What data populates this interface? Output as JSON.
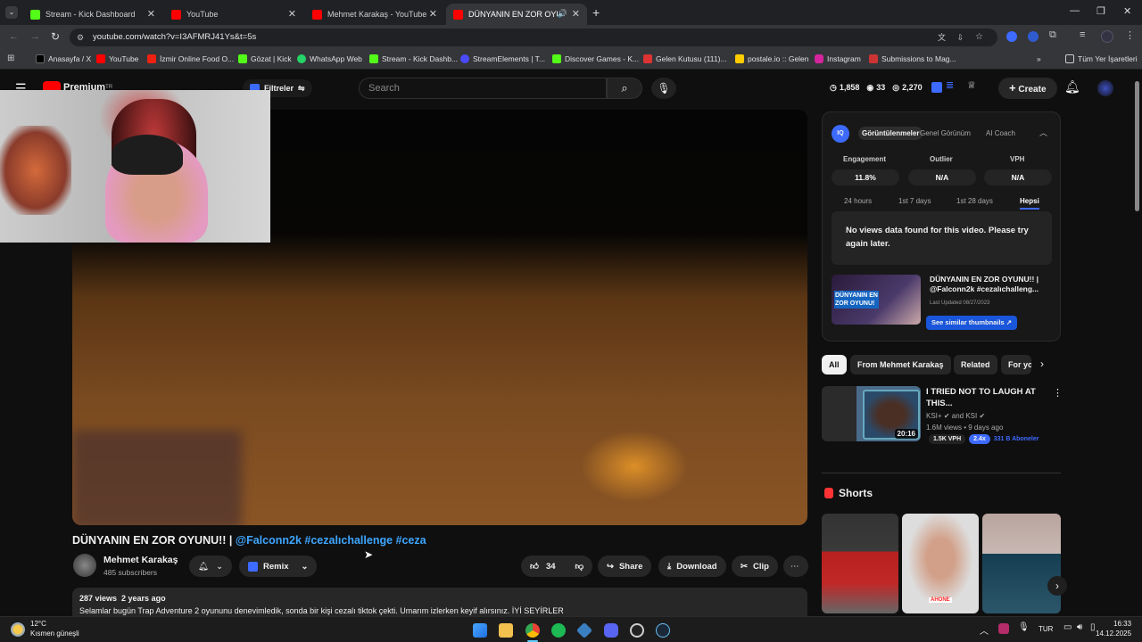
{
  "browser": {
    "tabs": [
      {
        "title": "Stream - Kick Dashboard",
        "color": "#53fc18"
      },
      {
        "title": "YouTube",
        "color": "#ff0000"
      },
      {
        "title": "Mehmet Karakaş - YouTube",
        "color": "#ff0000"
      },
      {
        "title": "DÜNYANIN EN ZOR OYUNU!",
        "color": "#ff0000"
      }
    ],
    "url": "youtube.com/watch?v=I3AFMRJ41Ys&t=5s",
    "bookmarks": [
      "Anasayfa / X",
      "YouTube",
      "İzmir Online Food O...",
      "Gözat | Kick",
      "WhatsApp Web",
      "Stream - Kick Dashb...",
      "StreamElements | T...",
      "Discover Games - K...",
      "Gelen Kutusu (111)...",
      "postale.io :: Gelen",
      "Instagram",
      "Submissions to Mag..."
    ],
    "all_bookmarks": "Tüm Yer İşaretleri"
  },
  "yt": {
    "logo": "Premium",
    "logo_sup": "TR",
    "filters": "Filtreler",
    "search_placeholder": "Search",
    "stats": {
      "a": "1,858",
      "b": "33",
      "c": "2,270"
    },
    "create": "Create",
    "video_title": "DÜNYANIN EN ZOR OYUNU!! | ",
    "video_tags": "@Falconn2k #cezalıchallenge #ceza",
    "channel": "Mehmet Karakaş",
    "subs": "485 subscribers",
    "remix": "Remix",
    "likes": "34",
    "share": "Share",
    "download": "Download",
    "clip": "Clip",
    "desc_meta": "287 views  2 years ago",
    "desc_text": "Selamlar bugün Trap Adventure 2 oyununu denevimledik, sonda bir kişi cezalı tiktok çekti. Umarım izlerken keyif alırsınız. İYİ SEYİRLER"
  },
  "iq": {
    "tabs": [
      "Görüntülenmeler",
      "Genel Görünüm",
      "AI Coach"
    ],
    "metrics": [
      {
        "label": "Engagement",
        "value": "11.8%"
      },
      {
        "label": "Outlier",
        "value": "N/A"
      },
      {
        "label": "VPH",
        "value": "N/A"
      }
    ],
    "ranges": [
      "24 hours",
      "1st 7 days",
      "1st 28 days",
      "Hepsi"
    ],
    "no_data": "No views data found for this video. Please try again later.",
    "thumb_title": "DÜNYANIN EN ZOR OYUNU!! | @Falconn2k #cezalıchalleng...",
    "thumb_text": "DÜNYANIN EN ZOR OYUNU!",
    "last_updated": "Last Updated 08/27/2023",
    "similar_btn": "See similar thumbnails ↗"
  },
  "related": {
    "chips": [
      "All",
      "From Mehmet Karakaş",
      "Related",
      "For yo"
    ],
    "item": {
      "title": "I TRIED NOT TO LAUGH AT THIS...",
      "channel": "KSI+",
      "and": "and KSI",
      "meta": "1.6M views • 9 days ago",
      "duration": "20:16",
      "vph": "1.5K VPH",
      "mult": "2.4x",
      "subs": "331 B Aboneler"
    },
    "shorts_label": "Shorts",
    "short_caption": "AHONE"
  },
  "taskbar": {
    "temp": "12°C",
    "weather": "Kısmen güneşli",
    "lang": "TUR",
    "time": "16:33",
    "date": "14.12.2025"
  }
}
